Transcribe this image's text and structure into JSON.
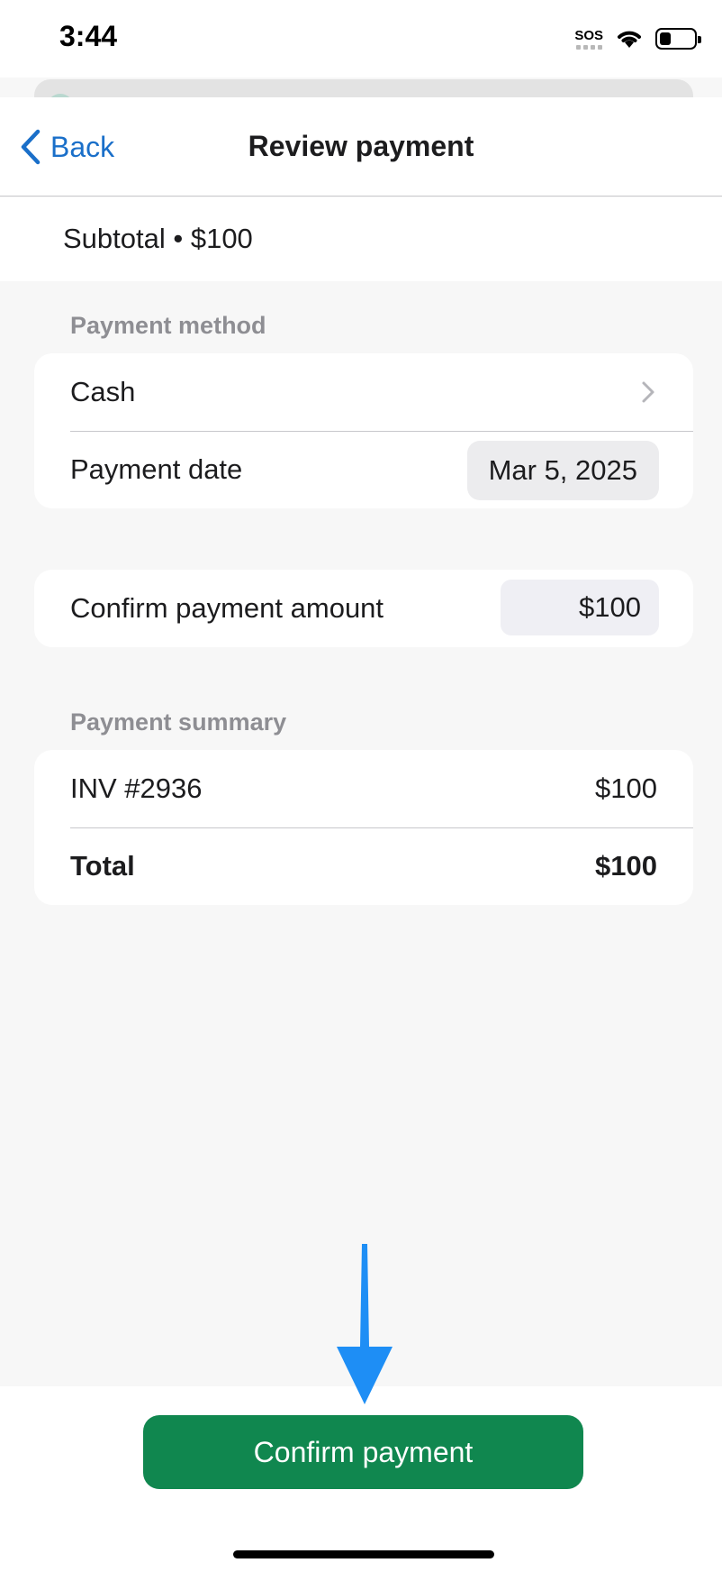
{
  "status_bar": {
    "time": "3:44",
    "sos_label": "SOS",
    "icons": [
      "sos-icon",
      "wifi-icon",
      "battery-icon"
    ]
  },
  "nav": {
    "back_label": "Back",
    "back_icon": "chevron-left-icon",
    "title": "Review payment"
  },
  "subtotal": {
    "text": "Subtotal • $100"
  },
  "payment_method_section": {
    "header": "Payment method",
    "method_label": "Cash",
    "method_icon": "chevron-right-icon",
    "date_label": "Payment date",
    "date_value": "Mar 5, 2025"
  },
  "confirm_amount": {
    "label": "Confirm payment amount",
    "value": "$100"
  },
  "summary_section": {
    "header": "Payment summary",
    "rows": [
      {
        "label": "INV #2936",
        "value": "$100"
      },
      {
        "label": "Total",
        "value": "$100"
      }
    ]
  },
  "footer": {
    "confirm_button_label": "Confirm payment"
  },
  "colors": {
    "accent_blue": "#1a6fc9",
    "confirm_green": "#10874f",
    "annotation_arrow": "#1e8ef5",
    "background": "#f7f7f7"
  }
}
